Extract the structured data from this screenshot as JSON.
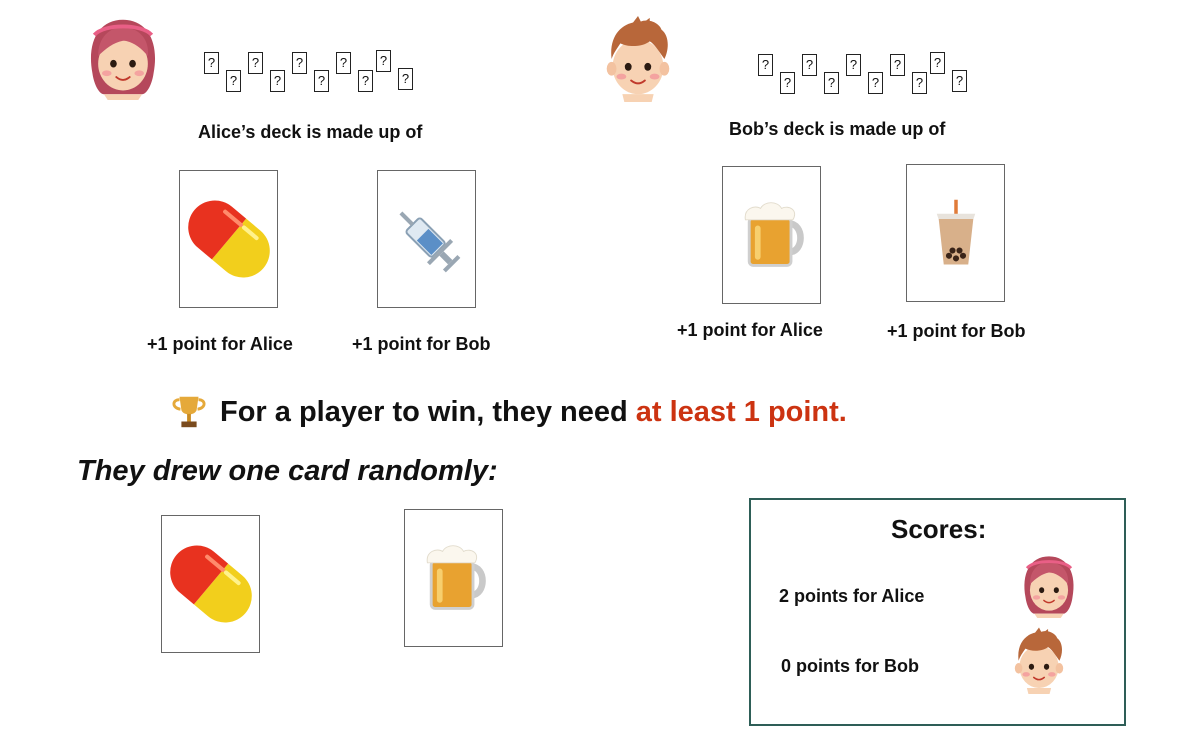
{
  "players": {
    "alice": {
      "avatar_icon": "girl-avatar-icon",
      "hidden_card_glyph": "?",
      "hidden_card_count": 10,
      "deck_caption": "Alice’s deck is made up of",
      "cards": [
        {
          "icon": "pill-icon",
          "label": "+1 point for Alice"
        },
        {
          "icon": "syringe-icon",
          "label": "+1 point for Bob"
        }
      ]
    },
    "bob": {
      "avatar_icon": "boy-avatar-icon",
      "hidden_card_glyph": "?",
      "hidden_card_count": 10,
      "deck_caption": "Bob’s deck is made up of",
      "cards": [
        {
          "icon": "beer-mug-icon",
          "label": "+1 point for Alice"
        },
        {
          "icon": "bubble-tea-icon",
          "label": "+1 point for Bob"
        }
      ]
    }
  },
  "rule": {
    "icon": "trophy-icon",
    "text_before": "For a player to win, they need ",
    "text_highlight": "at least 1 point.",
    "highlight_color": "#cc3311"
  },
  "drawn": {
    "title": "They drew one card randomly:",
    "cards": [
      {
        "icon": "pill-icon"
      },
      {
        "icon": "beer-mug-icon"
      }
    ]
  },
  "scores": {
    "title": "Scores:",
    "lines": [
      {
        "text": "2 points for Alice",
        "avatar_icon": "girl-avatar-icon"
      },
      {
        "text": "0 points for Bob",
        "avatar_icon": "boy-avatar-icon"
      }
    ],
    "border_color": "#2e5e57"
  }
}
